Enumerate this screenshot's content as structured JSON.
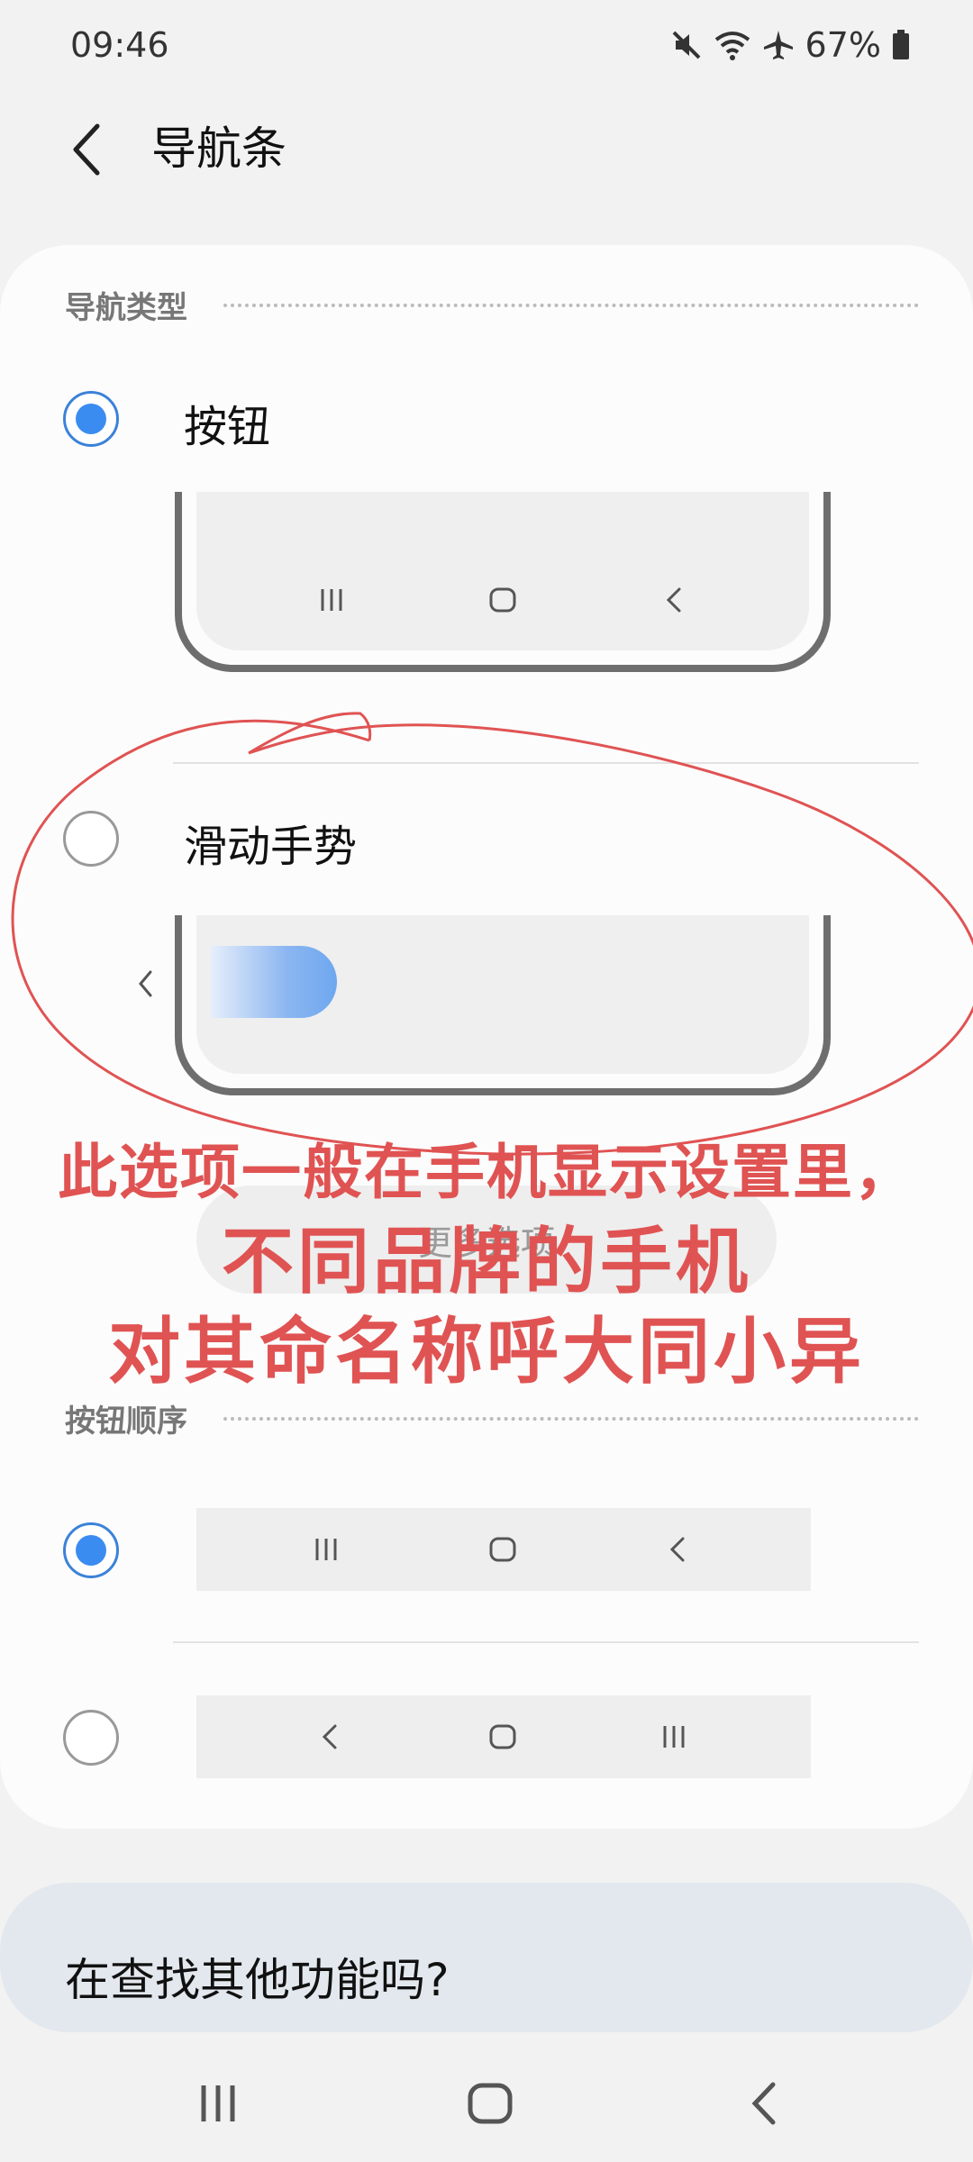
{
  "status_bar": {
    "time": "09:46",
    "battery": "67%",
    "icons": [
      "mute-icon",
      "wifi-icon",
      "airplane-icon",
      "battery-icon"
    ]
  },
  "app_bar": {
    "title": "导航条",
    "back_icon": "chevron-left-icon"
  },
  "nav_type": {
    "section_label": "导航类型",
    "options": [
      {
        "label": "按钮",
        "checked": true,
        "preview_icons": [
          "recents-icon",
          "home-icon",
          "back-icon"
        ]
      },
      {
        "label": "滑动手势",
        "checked": false,
        "preview_icons": [
          "back-hint-icon",
          "gesture-pill"
        ]
      }
    ]
  },
  "more_options_label": "更多选项",
  "button_order": {
    "section_label": "按钮顺序",
    "options": [
      {
        "checked": true,
        "icons": [
          "recents-icon",
          "home-icon",
          "back-icon"
        ]
      },
      {
        "checked": false,
        "icons": [
          "back-icon",
          "home-icon",
          "recents-icon"
        ]
      }
    ]
  },
  "annotation": {
    "line1": "此选项一般在手机显示设置里，",
    "line2": "不同品牌的手机",
    "line3": "对其命名称呼大同小异",
    "color": "#e05353"
  },
  "suggestion": {
    "text": "在查找其他功能吗?"
  },
  "system_nav": [
    "recents-icon",
    "home-icon",
    "back-icon"
  ],
  "colors": {
    "accent": "#3b8cf0",
    "card": "#fcfcfc",
    "background": "#f2f2f2"
  }
}
